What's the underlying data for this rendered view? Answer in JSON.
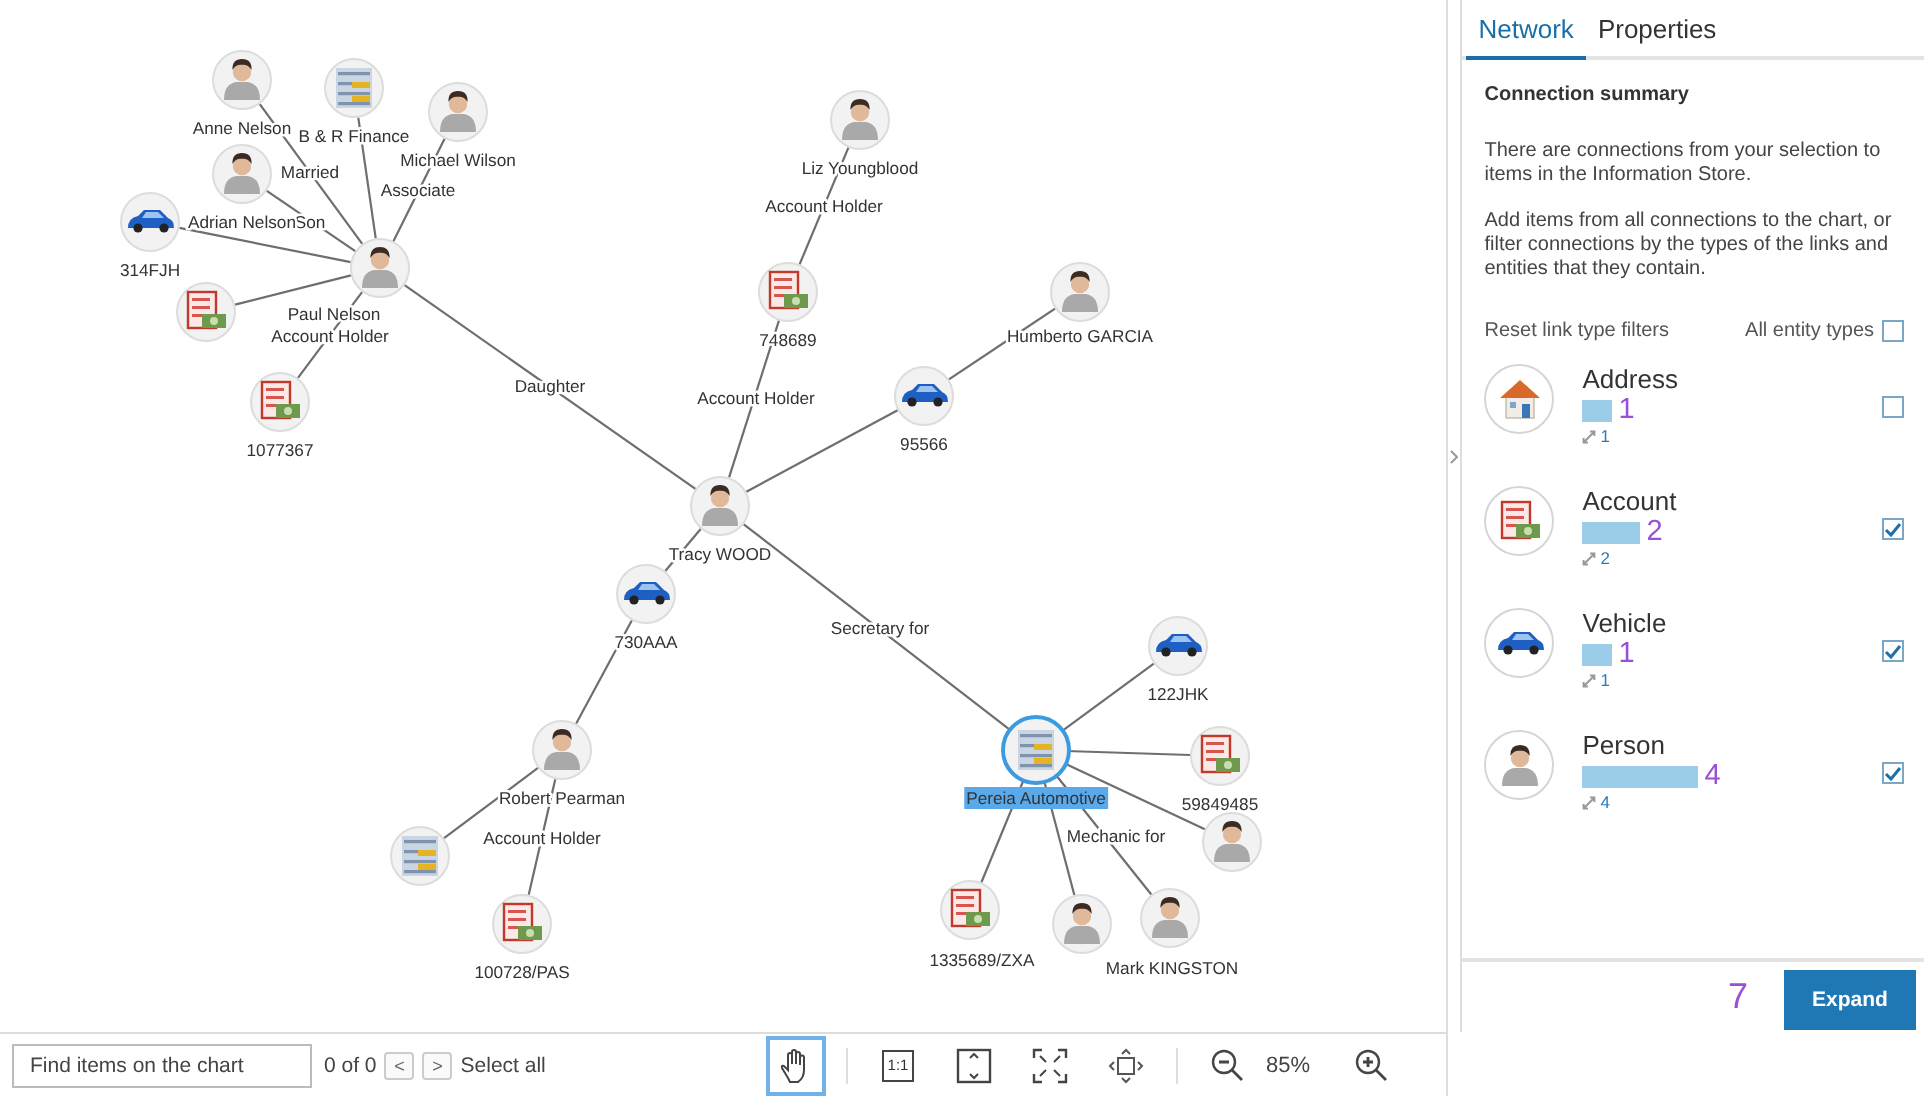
{
  "chart": {
    "nodes": [
      {
        "kind": "person",
        "label": "Anne Nelson",
        "selected": false
      },
      {
        "kind": "organization",
        "label": "B & R Finance",
        "selected": false
      },
      {
        "kind": "person",
        "label": "Michael Wilson",
        "selected": false
      },
      {
        "kind": "person",
        "label": "Adrian Nelson",
        "selected": false
      },
      {
        "kind": "vehicle",
        "label": "314FJH",
        "selected": false
      },
      {
        "kind": "person",
        "label": "Paul Nelson",
        "selected": false
      },
      {
        "kind": "account",
        "selected": false
      },
      {
        "kind": "account",
        "label": "1077367",
        "selected": false
      },
      {
        "kind": "person",
        "label": "Liz Youngblood",
        "selected": false
      },
      {
        "kind": "account",
        "label": "748689",
        "selected": false
      },
      {
        "kind": "person",
        "label": "Humberto GARCIA",
        "selected": false
      },
      {
        "kind": "vehicle",
        "label": "95566",
        "selected": false
      },
      {
        "kind": "person",
        "label": "Tracy WOOD",
        "selected": false
      },
      {
        "kind": "vehicle",
        "label": "730AAA",
        "selected": false
      },
      {
        "kind": "person",
        "label": "Robert Pearman",
        "selected": false
      },
      {
        "kind": "organization",
        "selected": false
      },
      {
        "kind": "account",
        "label": "100728/PAS",
        "selected": false
      },
      {
        "kind": "organization",
        "label": "Pereia Automotive",
        "selected": true
      },
      {
        "kind": "vehicle",
        "label": "122JHK",
        "selected": false
      },
      {
        "kind": "account",
        "label": "59849485",
        "selected": false
      },
      {
        "kind": "person",
        "selected": false
      },
      {
        "kind": "account",
        "label": "1335689/ZXA",
        "selected": false
      },
      {
        "kind": "person",
        "selected": false
      },
      {
        "kind": "person",
        "label": "Mark KINGSTON",
        "selected": false
      }
    ],
    "link_labels": [
      "Married",
      "Associate",
      "Son",
      "Account Holder",
      "Daughter",
      "Account Holder",
      "Account Holder",
      "Account Holder",
      "Secretary for",
      "Mechanic for"
    ]
  },
  "toolbar": {
    "search": {
      "placeholder": "Find items on the chart"
    },
    "match_count": "0 of 0",
    "prev": "<",
    "next": ">",
    "select_all": "Select all",
    "tools": [
      {
        "kind": "hand",
        "selected": true
      },
      {
        "kind": "actual-size",
        "text": "1:1",
        "selected": false
      },
      {
        "kind": "fit-height",
        "selected": false
      },
      {
        "kind": "fit-all",
        "selected": false
      },
      {
        "kind": "move",
        "selected": false
      },
      {
        "kind": "zoom-out",
        "selected": false
      },
      {
        "kind": "zoom-level",
        "text": "85%"
      },
      {
        "kind": "zoom-in",
        "selected": false
      }
    ]
  },
  "panel": {
    "tabs": [
      {
        "label": "Network",
        "selected": true
      },
      {
        "label": "Properties",
        "selected": false
      }
    ],
    "heading": "Connection summary",
    "paragraphs": [
      "There are connections from your selection to items in the Information Store.",
      "Add items from all connections to the chart, or filter connections by the types of the links and entities that they contain."
    ],
    "reset_link": "Reset link type filters",
    "all_types": {
      "label": "All entity types",
      "checked": false
    },
    "entity_types": [
      {
        "kind": "address",
        "name": "Address",
        "count": "1",
        "links": "1",
        "checked": false
      },
      {
        "kind": "account",
        "name": "Account",
        "count": "2",
        "links": "2",
        "checked": true
      },
      {
        "kind": "vehicle",
        "name": "Vehicle",
        "count": "1",
        "links": "1",
        "checked": true
      },
      {
        "kind": "person",
        "name": "Person",
        "count": "4",
        "links": "4",
        "checked": true
      }
    ],
    "total": "7",
    "expand": "Expand"
  }
}
